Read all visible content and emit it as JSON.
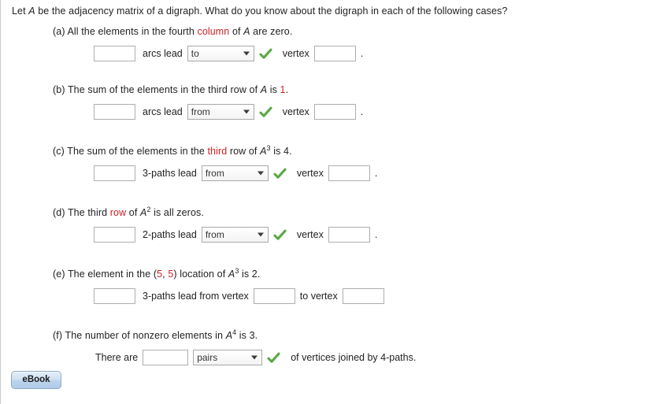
{
  "prompt": {
    "pre": "Let ",
    "var": "A",
    "post": " be the adjacency matrix of a digraph. What do you know about the digraph in each of the following cases?"
  },
  "colors": {
    "highlight_red": "#cc2127",
    "check_green": "#5aa845",
    "input_border": "#aeaeae",
    "button_border": "#8fa9c4"
  },
  "parts": [
    {
      "id": "a",
      "label_prefix": "(a)",
      "statement": [
        {
          "text": "All the elements in the fourth ",
          "style": "normal"
        },
        {
          "text": "column",
          "style": "red"
        },
        {
          "text": " of ",
          "style": "normal"
        },
        {
          "text": "A",
          "style": "italic"
        },
        {
          "text": " are zero.",
          "style": "normal"
        }
      ],
      "answer": {
        "input1_value": "",
        "mid_text": "arcs lead",
        "select_value": "to",
        "select_options": [
          "to",
          "from"
        ],
        "checkmark": true,
        "after_text": "vertex",
        "input2_value": "",
        "trailing": "."
      }
    },
    {
      "id": "b",
      "label_prefix": "(b)",
      "statement": [
        {
          "text": "The sum of the elements in the third row of ",
          "style": "normal"
        },
        {
          "text": "A",
          "style": "italic"
        },
        {
          "text": " is ",
          "style": "normal"
        },
        {
          "text": "1",
          "style": "red"
        },
        {
          "text": ".",
          "style": "normal"
        }
      ],
      "answer": {
        "input1_value": "",
        "mid_text": "arcs lead",
        "select_value": "from",
        "select_options": [
          "to",
          "from"
        ],
        "checkmark": true,
        "after_text": "vertex",
        "input2_value": "",
        "trailing": "."
      }
    },
    {
      "id": "c",
      "label_prefix": "(c)",
      "statement": [
        {
          "text": "The sum of the elements in the ",
          "style": "normal"
        },
        {
          "text": "third",
          "style": "red"
        },
        {
          "text": " row of ",
          "style": "normal"
        },
        {
          "text": "A",
          "style": "italic-sup",
          "sup": "3"
        },
        {
          "text": " is 4.",
          "style": "normal"
        }
      ],
      "answer": {
        "input1_value": "",
        "mid_text": "3-paths lead",
        "select_value": "from",
        "select_options": [
          "to",
          "from"
        ],
        "checkmark": true,
        "after_text": "vertex",
        "input2_value": "",
        "trailing": "."
      }
    },
    {
      "id": "d",
      "label_prefix": "(d)",
      "statement": [
        {
          "text": "The third ",
          "style": "normal"
        },
        {
          "text": "row",
          "style": "red"
        },
        {
          "text": " of ",
          "style": "normal"
        },
        {
          "text": "A",
          "style": "italic-sup",
          "sup": "2"
        },
        {
          "text": " is all zeros.",
          "style": "normal"
        }
      ],
      "answer": {
        "input1_value": "",
        "mid_text": "2-paths lead",
        "select_value": "from",
        "select_options": [
          "to",
          "from"
        ],
        "checkmark": true,
        "after_text": "vertex",
        "input2_value": "",
        "trailing": "."
      }
    },
    {
      "id": "e",
      "label_prefix": "(e)",
      "statement": [
        {
          "text": "The element in the (",
          "style": "normal"
        },
        {
          "text": "5",
          "style": "red"
        },
        {
          "text": ", ",
          "style": "normal"
        },
        {
          "text": "5",
          "style": "red"
        },
        {
          "text": ") location of ",
          "style": "normal"
        },
        {
          "text": "A",
          "style": "italic-sup",
          "sup": "3"
        },
        {
          "text": " is 2.",
          "style": "normal"
        }
      ],
      "answer": {
        "input1_value": "",
        "mid_text": "3-paths lead from vertex",
        "input2_value": "",
        "after_text": "to vertex",
        "input3_value": "",
        "checkmark": false
      }
    },
    {
      "id": "f",
      "label_prefix": "(f)",
      "statement": [
        {
          "text": "The number of nonzero elements in ",
          "style": "normal"
        },
        {
          "text": "A",
          "style": "italic-sup",
          "sup": "4"
        },
        {
          "text": " is 3.",
          "style": "normal"
        }
      ],
      "answer": {
        "pre_text": "There are",
        "input1_value": "",
        "select_value": "pairs",
        "select_options": [
          "pairs",
          "vertices"
        ],
        "checkmark": true,
        "after_text": "of vertices joined by 4-paths."
      }
    }
  ],
  "ebook_button": {
    "label": "eBook"
  }
}
